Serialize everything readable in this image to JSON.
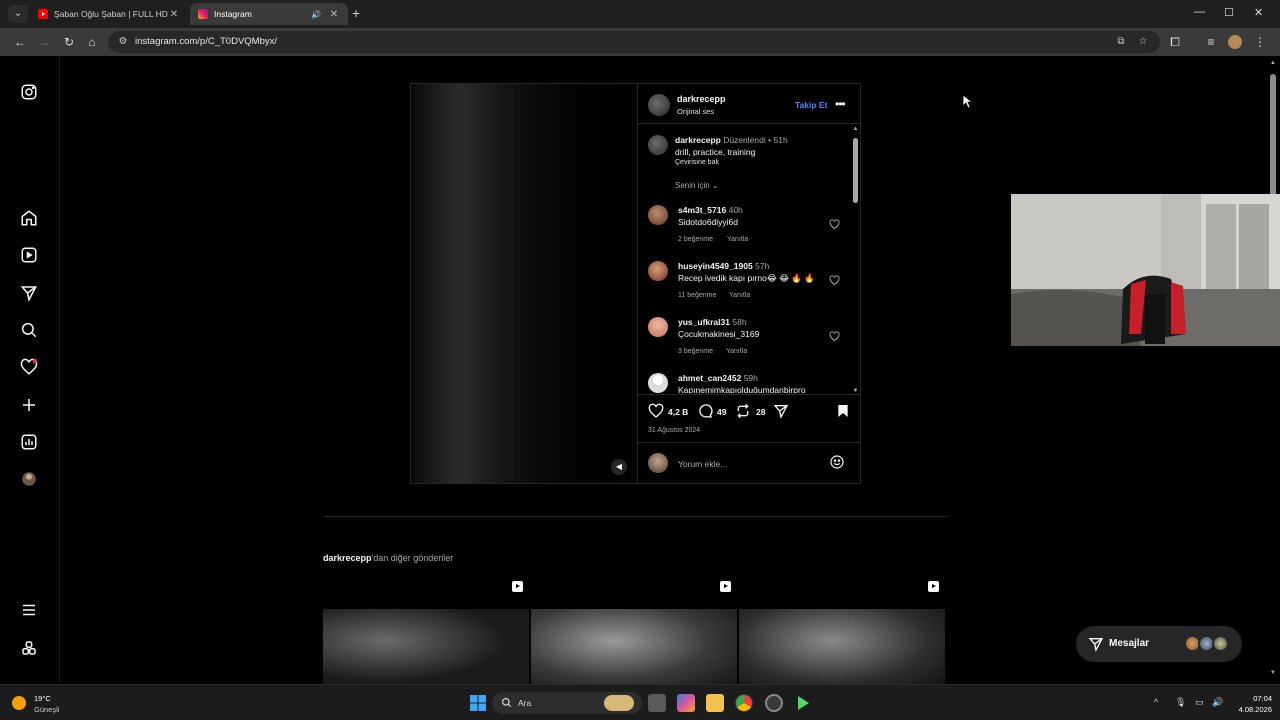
{
  "browser": {
    "tabs": [
      {
        "title": "Şaban Oğlu Şaban | FULL HD - Y",
        "favicon": "youtube-icon"
      },
      {
        "title": "Instagram",
        "favicon": "instagram-icon",
        "active": true
      }
    ],
    "url": "instagram.com/p/C_T0DVQMbyx/"
  },
  "post": {
    "author": "darkrecepp",
    "audio": "Orijinal ses",
    "follow_label": "Takip Et",
    "caption": {
      "user": "darkrecepp",
      "edited": "Düzenlendi",
      "time": "51h",
      "text": "drill, practice, training",
      "translate": "Çevirisine bak"
    },
    "sort_label": "Senin için",
    "comments": [
      {
        "user": "s4m3t_5716",
        "time": "40h",
        "text": "Sidotdo6diyyi6d",
        "likes": "2 beğenme",
        "reply": "Yanıtla"
      },
      {
        "user": "huseyin4549_1905",
        "time": "57h",
        "text": "Recep ivedik kapı pırno😂 😂 🔥 🔥",
        "likes": "11 beğenme",
        "reply": "Yanıtla"
      },
      {
        "user": "yus_ufkral31",
        "time": "58h",
        "text": "Çocukmakinesi_3169",
        "likes": "3 beğenme",
        "reply": "Yanıtla"
      },
      {
        "user": "ahmet_can2452",
        "time": "59h",
        "text": "Kapınemimkapıolduğumdanbirpro",
        "likes": "",
        "reply": ""
      }
    ],
    "likes_count": "4,2 B",
    "comments_count": "49",
    "reposts_count": "28",
    "date": "31 Ağustos 2024",
    "add_comment_placeholder": "Yorum ekle..."
  },
  "more_posts": {
    "user": "darkrecepp",
    "suffix": "'dan diğer gönderiler"
  },
  "messages": {
    "label": "Mesajlar"
  },
  "taskbar": {
    "weather_temp": "19°C",
    "weather_desc": "Güneşli",
    "search_label": "Ara",
    "time": "07:04",
    "date": "4.08.2026"
  },
  "colors": {
    "accent": "#4f87f5",
    "background": "#000000",
    "border": "#262626",
    "notification": "#ff3040"
  }
}
